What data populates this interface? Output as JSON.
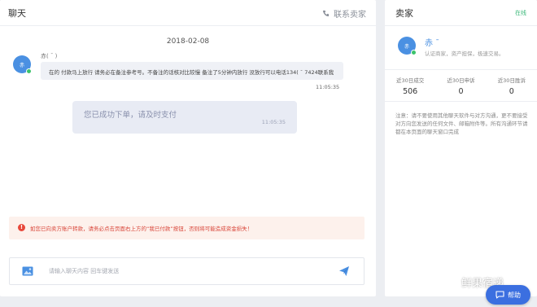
{
  "chat": {
    "title": "聊天",
    "contact_seller": "联系卖家",
    "date": "2018-02-08",
    "sender_name": "赤(  ˉ )",
    "avatar_text": "赤",
    "message": "在的  付款马上放行  请务必在备注参考号。不备注的话核对比较慢 备注了5分钟内放行 没放行可以电话134(  ˉ  7424联系我",
    "message_time": "11:05:35",
    "system_message": "您已成功下单，请及时支付",
    "system_time": "11:05:35",
    "warning": "如您已向卖方账户转款，请务必点击页面右上方的“我已付款”按钮，否则将可能造成资金损失！",
    "input_placeholder": "请输入聊天内容 回车键发送"
  },
  "seller": {
    "title": "卖家",
    "status": "在线",
    "avatar_text": "赤",
    "name": "赤  ˉ  ",
    "certification": "认证商家，资产担保，极速交易。",
    "stats": [
      {
        "label": "近30日成交",
        "value": "506"
      },
      {
        "label": "近30日申诉",
        "value": "0"
      },
      {
        "label": "近30日胜诉",
        "value": "0"
      }
    ],
    "notice": "注意：请不要使用其他聊天软件与对方沟通，更不要接受对方向您发送的任何文件、邮箱附件等。所有沟通环节请都在本页面的聊天窗口完成"
  },
  "watermark": "鲜果宿递",
  "help_label": "帮助",
  "colors": {
    "accent": "#4a90e2",
    "online": "#3cb87a",
    "warning": "#d9463a",
    "help": "#3b6fe0"
  }
}
